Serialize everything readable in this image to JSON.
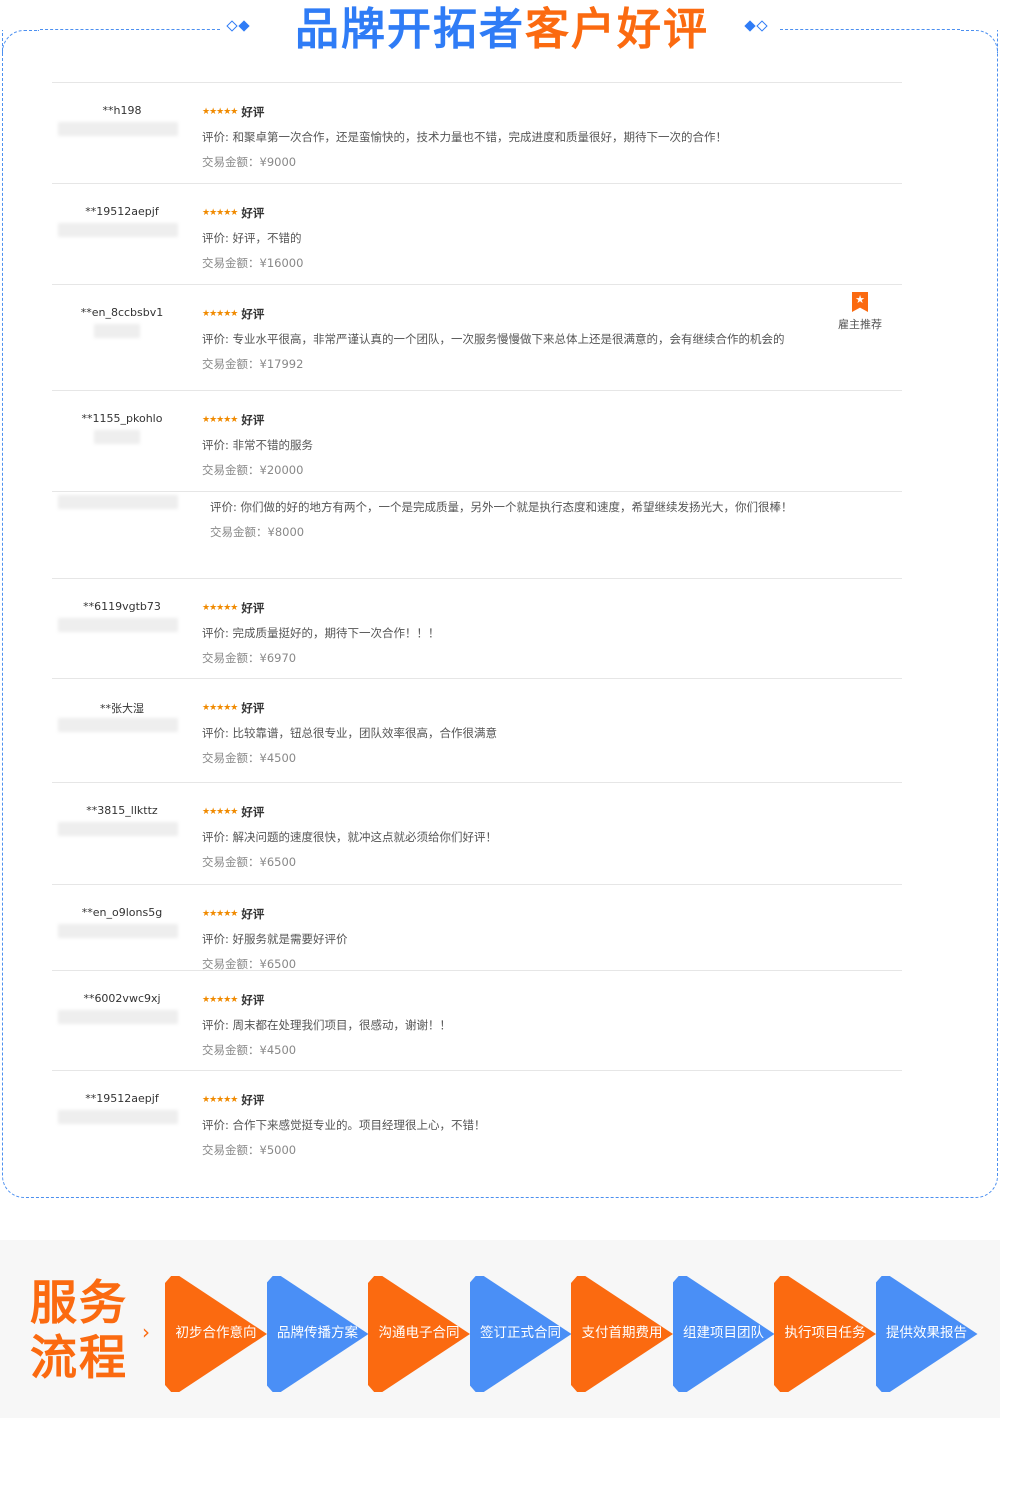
{
  "header": {
    "title_blue": "品牌开拓者",
    "title_orange": "客户好评"
  },
  "colors": {
    "accent_blue": "#2f7cf6",
    "accent_orange": "#fb6a10",
    "star": "#f08a00"
  },
  "reviews": [
    {
      "user": "**h198",
      "stars": "★★★★★",
      "rating": "好评",
      "comment": "评价: 和聚卓第一次合作，还是蛮愉快的，技术力量也不错，完成进度和质量很好，期待下一次的合作！",
      "amount": "交易金额：¥9000"
    },
    {
      "user": "**19512aepjf",
      "stars": "★★★★★",
      "rating": "好评",
      "comment": "评价: 好评，不错的",
      "amount": "交易金额：¥16000"
    },
    {
      "user": "**en_8ccbsbv1",
      "stars": "★★★★★",
      "rating": "好评",
      "comment": "评价: 专业水平很高，非常严谨认真的一个团队，一次服务慢慢做下来总体上还是很满意的，会有继续合作的机会的",
      "amount": "交易金额：¥17992",
      "badge": "雇主推荐"
    },
    {
      "user": "**1155_pkohlo",
      "stars": "★★★★★",
      "rating": "好评",
      "comment": "评价: 非常不错的服务",
      "amount": "交易金额：¥20000"
    },
    {
      "user": "",
      "stars": "",
      "rating": "",
      "comment": "评价: 你们做的好的地方有两个，一个是完成质量，另外一个就是执行态度和速度，希望继续发扬光大，你们很棒！",
      "amount": "交易金额：¥8000"
    },
    {
      "user": "**6119vgtb73",
      "stars": "★★★★★",
      "rating": "好评",
      "comment": "评价: 完成质量挺好的，期待下一次合作！！！",
      "amount": "交易金额：¥6970"
    },
    {
      "user": "**张大湿",
      "stars": "★★★★★",
      "rating": "好评",
      "comment": "评价: 比较靠谱，钮总很专业，团队效率很高，合作很满意",
      "amount": "交易金额：¥4500"
    },
    {
      "user": "**3815_llkttz",
      "stars": "★★★★★",
      "rating": "好评",
      "comment": "评价: 解决问题的速度很快，就冲这点就必须给你们好评！",
      "amount": "交易金额：¥6500"
    },
    {
      "user": "**en_o9lons5g",
      "stars": "★★★★★",
      "rating": "好评",
      "comment": "评价: 好服务就是需要好评价",
      "amount": "交易金额：¥6500"
    },
    {
      "user": "**6002vwc9xj",
      "stars": "★★★★★",
      "rating": "好评",
      "comment": "评价: 周末都在处理我们项目，很感动，谢谢！！",
      "amount": "交易金额：¥4500"
    },
    {
      "user": "**19512aepjf",
      "stars": "★★★★★",
      "rating": "好评",
      "comment": "评价: 合作下来感觉挺专业的。项目经理很上心，不错！",
      "amount": "交易金额：¥5000"
    }
  ],
  "service": {
    "title_line1": "服务",
    "title_line2": "流程",
    "arrow": "›",
    "steps": [
      {
        "label": "初步合作意向",
        "color": "orange"
      },
      {
        "label": "品牌传播方案",
        "color": "blue"
      },
      {
        "label": "沟通电子合同",
        "color": "orange"
      },
      {
        "label": "签订正式合同",
        "color": "blue"
      },
      {
        "label": "支付首期费用",
        "color": "orange"
      },
      {
        "label": "组建项目团队",
        "color": "blue"
      },
      {
        "label": "执行项目任务",
        "color": "orange"
      },
      {
        "label": "提供效果报告",
        "color": "blue"
      }
    ]
  }
}
